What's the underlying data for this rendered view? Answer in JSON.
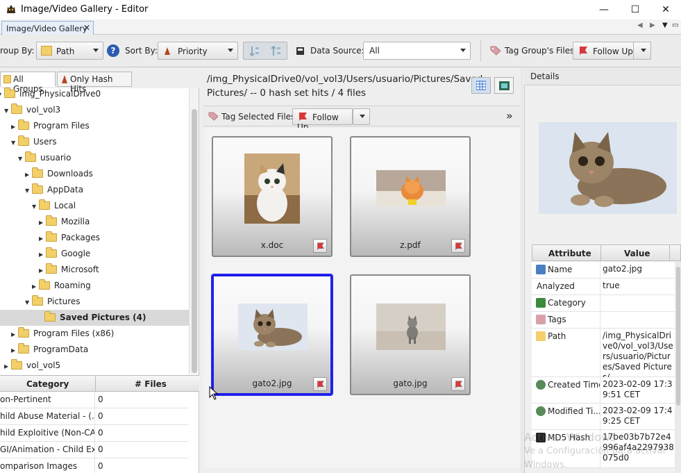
{
  "window": {
    "title": "Image/Video Gallery - Editor",
    "controls": {
      "minimize": "—",
      "maximize": "☐",
      "close": "✕"
    }
  },
  "tabs": [
    {
      "label": "Image/Video Gallery",
      "close": "✕"
    }
  ],
  "tabnav": {
    "prev": "◀",
    "next": "▶",
    "menu": "▼",
    "restore": "▭"
  },
  "toolbar": {
    "group_by_label": "roup By:",
    "group_by_value": "Path",
    "sort_by_label": "Sort By:",
    "sort_by_value": "Priority",
    "data_source_label": "Data Source:",
    "data_source_value": "All",
    "tag_group_label": "Tag Group's Files:",
    "tag_group_value": "Follow Up",
    "help_glyph": "?"
  },
  "left": {
    "tabs": [
      "All Groups",
      "Only Hash Hits"
    ],
    "tree": [
      {
        "label": "img_PhysicalDrive0",
        "indent": 0,
        "expanded": true
      },
      {
        "label": "vol_vol3",
        "indent": 1,
        "expanded": true
      },
      {
        "label": "Program Files",
        "indent": 2,
        "expanded": false
      },
      {
        "label": "Users",
        "indent": 2,
        "expanded": true
      },
      {
        "label": "usuario",
        "indent": 3,
        "expanded": true
      },
      {
        "label": "Downloads",
        "indent": 4,
        "expanded": false
      },
      {
        "label": "AppData",
        "indent": 4,
        "expanded": true
      },
      {
        "label": "Local",
        "indent": 5,
        "expanded": true
      },
      {
        "label": "Mozilla",
        "indent": 6,
        "expanded": false
      },
      {
        "label": "Packages",
        "indent": 6,
        "expanded": false
      },
      {
        "label": "Google",
        "indent": 6,
        "expanded": false
      },
      {
        "label": "Microsoft",
        "indent": 6,
        "expanded": false
      },
      {
        "label": "Roaming",
        "indent": 5,
        "expanded": false
      },
      {
        "label": "Pictures",
        "indent": 4,
        "expanded": true
      },
      {
        "label": "Saved Pictures (4)",
        "indent": 5,
        "expanded": null,
        "selected": true
      },
      {
        "label": "Program Files (x86)",
        "indent": 2,
        "expanded": false
      },
      {
        "label": "ProgramData",
        "indent": 2,
        "expanded": false
      },
      {
        "label": "vol_vol5",
        "indent": 1,
        "expanded": false
      }
    ],
    "category_table": {
      "headers": [
        "Category",
        "# Files"
      ],
      "rows": [
        {
          "category": "on-Pertinent",
          "files": "0"
        },
        {
          "category": "hild Abuse Material - (...",
          "files": "0"
        },
        {
          "category": "hild Exploitive (Non-CA...",
          "files": "0"
        },
        {
          "category": "GI/Animation - Child Ex...",
          "files": "0"
        },
        {
          "category": "omparison Images",
          "files": "0"
        }
      ]
    }
  },
  "center": {
    "path_label": "/img_PhysicalDrive0/vol_vol3/Users/usuario/Pictures/Saved Pictures/ -- 0 hash set hits / 4 files",
    "tag_selected_label": "Tag Selected Files:",
    "tag_selected_value": "Follow Up",
    "more_glyph": "»",
    "files": [
      {
        "name": "x.doc",
        "selected": false
      },
      {
        "name": "z.pdf",
        "selected": false
      },
      {
        "name": "gato2.jpg",
        "selected": true
      },
      {
        "name": "gato.jpg",
        "selected": false
      }
    ]
  },
  "details": {
    "header": "Details",
    "attr_headers": [
      "Attribute",
      "Value"
    ],
    "rows": [
      {
        "key": "Name",
        "value": "gato2.jpg",
        "icon": "file-icon"
      },
      {
        "key": "Analyzed",
        "value": "true",
        "icon": ""
      },
      {
        "key": "Category",
        "value": "",
        "icon": "category-icon"
      },
      {
        "key": "Tags",
        "value": "",
        "icon": "tag-icon"
      },
      {
        "key": "Path",
        "value": "/img_PhysicalDrive0/vol_vol3/Users/usuario/Pictures/Saved Pictures/",
        "icon": "folder-icon"
      },
      {
        "key": "Created Time",
        "value": "2023-02-09 17:39:51 CET",
        "icon": "clock-icon"
      },
      {
        "key": "Modified Ti...",
        "value": "2023-02-09 17:49:25 CET",
        "icon": "clock-icon"
      },
      {
        "key": "MD5 Hash",
        "value": "17be03b7b72e4996af4a2297938075d0",
        "icon": "hash-icon"
      }
    ],
    "watermark_line1": "Activar Windows",
    "watermark_line2": "Ve a Configuración para activar",
    "watermark_line3": "Windows."
  },
  "colors": {
    "selection_border": "#1e1ee6",
    "tag_red": "#d8383a"
  }
}
